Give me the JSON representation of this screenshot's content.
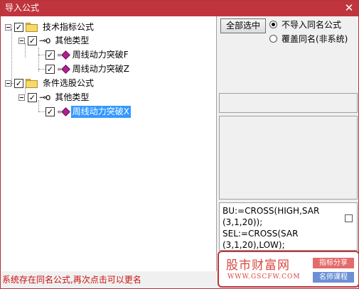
{
  "window": {
    "title": "导入公式",
    "close_glyph": "✕"
  },
  "tree": {
    "nodes": [
      {
        "label": "技术指标公式",
        "checked": true,
        "icon": "folder-icon"
      },
      {
        "label": "其他类型",
        "checked": true,
        "icon": "key-icon"
      },
      {
        "label": "周线动力突破F",
        "checked": true,
        "icon": "formula-icon"
      },
      {
        "label": "周线动力突破Z",
        "checked": true,
        "icon": "formula-icon"
      },
      {
        "label": "条件选股公式",
        "checked": true,
        "icon": "folder-icon"
      },
      {
        "label": "其他类型",
        "checked": true,
        "icon": "key-icon"
      },
      {
        "label": "周线动力突破X",
        "checked": true,
        "icon": "formula-icon",
        "selected": true
      }
    ],
    "check_glyph": "✓",
    "key_glyph": "⊸o"
  },
  "actions": {
    "select_all_label": "全部选中",
    "options": [
      {
        "label": "不导入同名公式",
        "selected": true
      },
      {
        "label": "覆盖同名(非系统)",
        "selected": false
      }
    ]
  },
  "code": {
    "lines": [
      "BU:=CROSS(HIGH,SAR",
      "(3,1,20));",
      "SEL:=CROSS(SAR",
      "(3,1,20),LOW);"
    ]
  },
  "watermark": {
    "name": "股市财富网",
    "url": "WWW.GSCFW.COM",
    "tag1": "指标分享",
    "tag2": "名师课程"
  },
  "status": {
    "message": "系统存在同名公式,再次点击可以更名"
  },
  "colors": {
    "titlebar": "#c0353d",
    "selection": "#3399ff",
    "status_text": "#cc1010"
  }
}
